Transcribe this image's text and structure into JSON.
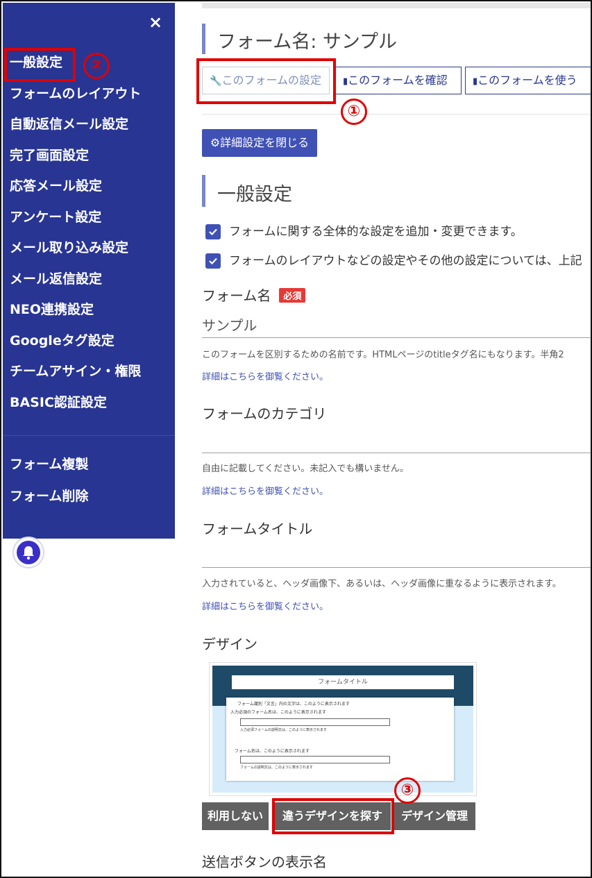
{
  "sidebar": {
    "close_label": "×",
    "items": [
      {
        "label": "一般設定"
      },
      {
        "label": "フォームのレイアウト"
      },
      {
        "label": "自動返信メール設定"
      },
      {
        "label": "完了画面設定"
      },
      {
        "label": "応答メール設定"
      },
      {
        "label": "アンケート設定"
      },
      {
        "label": "メール取り込み設定"
      },
      {
        "label": "メール返信設定"
      },
      {
        "label": "NEO連携設定"
      },
      {
        "label": "Googleタグ設定"
      },
      {
        "label": "チームアサイン・権限"
      },
      {
        "label": "BASIC認証設定"
      }
    ],
    "items2": [
      {
        "label": "フォーム複製"
      },
      {
        "label": "フォーム削除"
      }
    ]
  },
  "header": {
    "title": "フォーム名: サンプル"
  },
  "toolbar": {
    "settings_label": "このフォームの設定",
    "confirm_label": "このフォームを確認",
    "use_label": "このフォームを使う",
    "detail_close_label": "詳細設定を閉じる"
  },
  "section": {
    "title": "一般設定",
    "checks": [
      {
        "text": "フォームに関する全体的な設定を追加・変更できます。"
      },
      {
        "text": "フォームのレイアウトなどの設定やその他の設定については、上記"
      }
    ]
  },
  "fields": {
    "form_name": {
      "label": "フォーム名",
      "badge": "必須",
      "value": "サンプル",
      "help": "このフォームを区別するための名前です。HTMLページのtitleタグ名にもなります。半角2",
      "link": "詳細はこちらを御覧ください。"
    },
    "category": {
      "label": "フォームのカテゴリ",
      "help": "自由に記載してください。未記入でも構いません。",
      "link": "詳細はこちらを御覧ください。"
    },
    "form_title": {
      "label": "フォームタイトル",
      "help": "入力されていると、ヘッダ画像下、あるいは、ヘッダ画像に重なるように表示されます。",
      "link": "詳細はこちらを御覧ください。"
    },
    "design": {
      "label": "デザイン",
      "preview": {
        "title": "フォームタイトル",
        "line1": "フォーム識別「文言」内の文字は、このように表示されます",
        "line2": "入力必須のフォーム名は、このように表示されます",
        "line3": "入力必須フォームの説明文は、このように表示されます",
        "line4": "フォーム名は、このように表示されます",
        "line5": "フォームの説明文は、このように表示されます"
      },
      "buttons": {
        "none": "利用しない",
        "find": "違うデザインを探す",
        "manage": "デザイン管理"
      }
    },
    "submit": {
      "label": "送信ボタンの表示名"
    }
  },
  "annotations": {
    "n1": "①",
    "n2": "②",
    "n3": "③",
    "color": "#e00000"
  },
  "colors": {
    "sidebar_bg": "#283593",
    "primary": "#3f51b5",
    "accent_bar": "#7986cb",
    "required_badge": "#e53935"
  }
}
